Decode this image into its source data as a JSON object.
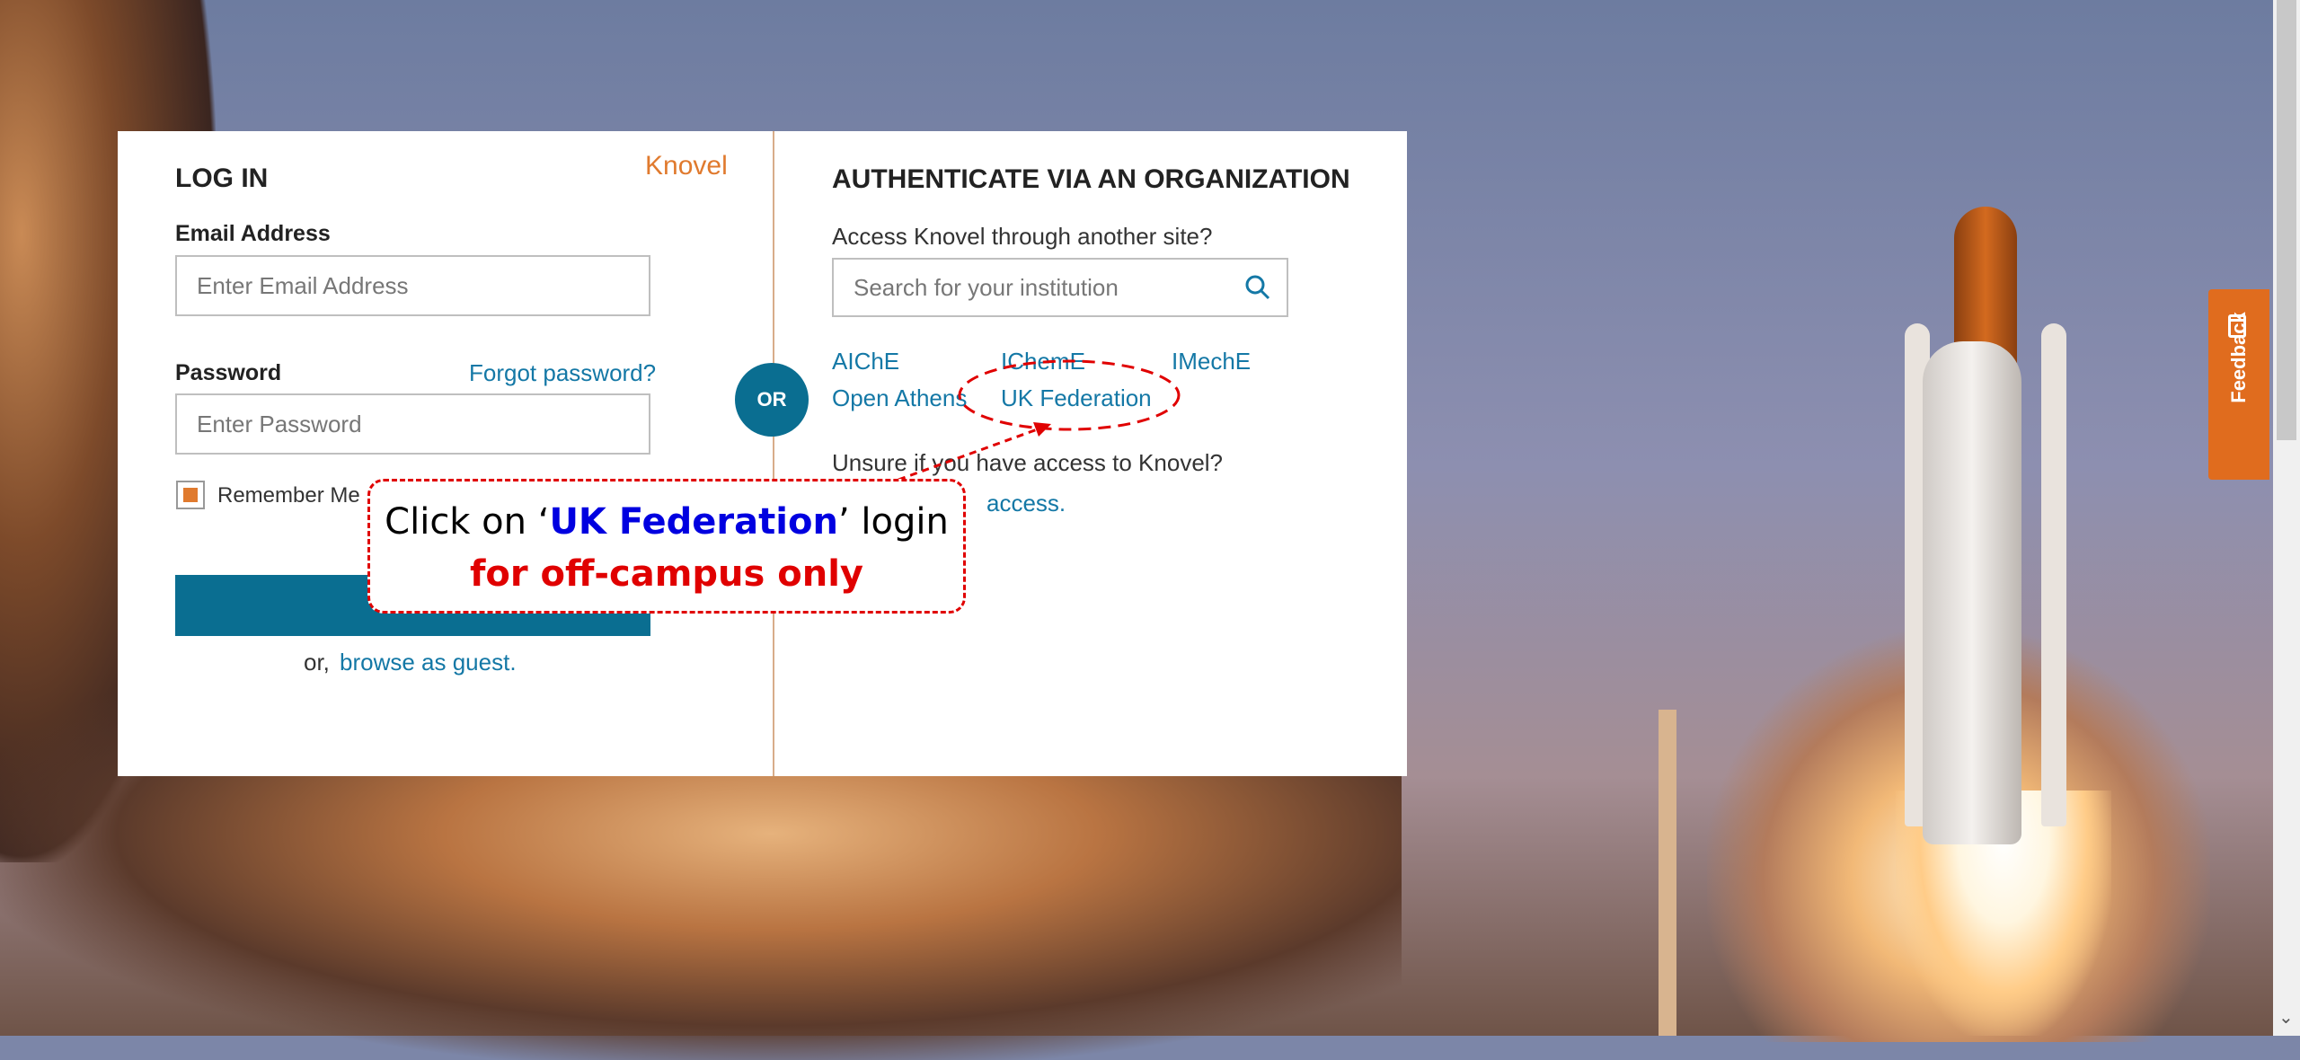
{
  "login": {
    "title": "LOG IN",
    "brand": "Knovel",
    "email_label": "Email Address",
    "email_placeholder": "Enter Email Address",
    "password_label": "Password",
    "forgot_link": "Forgot password?",
    "password_placeholder": "Enter Password",
    "remember_label": "Remember Me",
    "guest_prefix": "or,",
    "guest_link": "browse as guest."
  },
  "divider": {
    "or_label": "OR"
  },
  "org": {
    "title": "AUTHENTICATE VIA AN ORGANIZATION",
    "subtitle": "Access Knovel through another site?",
    "search_placeholder": "Search for your institution",
    "links": [
      "AIChE",
      "IChemE",
      "IMechE",
      "Open Athens",
      "UK Federation"
    ],
    "unsure_text": "Unsure if you have access to Knovel?",
    "check_access_tail": "access."
  },
  "feedback": {
    "label": "Feedback"
  },
  "annotation": {
    "line1_prefix": "Click on ‘",
    "line1_highlight": "UK Federation",
    "line1_suffix": "’ login",
    "line2": "for off-campus only"
  },
  "colors": {
    "accent": "#0a6e91",
    "brand_orange": "#e07a2e",
    "link": "#1478a6",
    "annotation_red": "#e00000"
  },
  "icons": [
    "search-icon",
    "feedback-icon",
    "scroll-down-arrow-icon"
  ]
}
